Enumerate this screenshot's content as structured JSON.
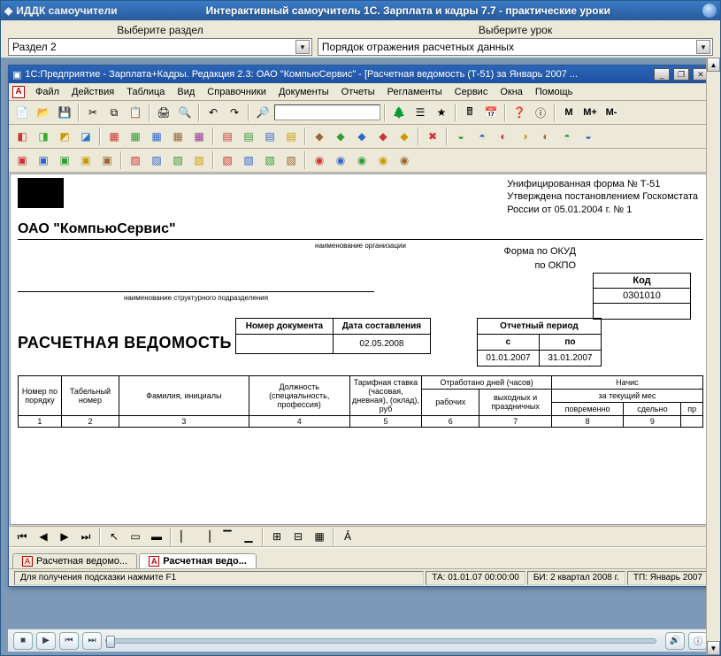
{
  "outer": {
    "app_name": "ИДДК самоучители",
    "title": "Интерактивный самоучитель 1С. Зарплата и кадры 7.7 - практические уроки"
  },
  "selectors": {
    "section_label": "Выберите раздел",
    "lesson_label": "Выберите урок",
    "section_value": "Раздел 2",
    "lesson_value": "Порядок отражения  расчетных данных"
  },
  "inner": {
    "title": "1С:Предприятие - Зарплата+Кадры. Редакция 2.3: ОАО \"КомпьюСервис\" - [Расчетная ведомость (Т-51) за Январь 2007 ..."
  },
  "menu": {
    "items": [
      "Файл",
      "Действия",
      "Таблица",
      "Вид",
      "Справочники",
      "Документы",
      "Отчеты",
      "Регламенты",
      "Сервис",
      "Окна",
      "Помощь"
    ]
  },
  "tb3_text": {
    "m": "M",
    "mplus": "M+",
    "mminus": "M-"
  },
  "doc": {
    "approval1": "Унифицированная форма № Т-51",
    "approval2": "Утверждена постановлением Госкомстата",
    "approval3": "России от 05.01.2004 г. № 1",
    "org_name": "ОАО \"КомпьюСервис\"",
    "org_sub": "наименование организации",
    "subdiv_sub": "наименование структурного подразделения",
    "form_okud_lbl": "Форма по ОКУД",
    "okpo_lbl": "по ОКПО",
    "kod_hdr": "Код",
    "kod_val": "0301010",
    "doc_title": "РАСЧЕТНАЯ ВЕДОМОСТЬ",
    "docnum_hdr": "Номер документа",
    "date_hdr": "Дата составления",
    "date_val": "02.05.2008",
    "period_hdr": "Отчетный период",
    "period_from_hdr": "с",
    "period_to_hdr": "по",
    "period_from": "01.01.2007",
    "period_to": "31.01.2007",
    "col": {
      "seq": "Номер по порядку",
      "tab": "Табельный номер",
      "fio": "Фамилия, инициалы",
      "pos": "Должность (специальность, профессия)",
      "rate": "Тарифная ставка (часовая, дневная), (оклад), руб",
      "worked_hdr": "Отработано дней (часов)",
      "worked_work": "рабочих",
      "worked_holiday": "выходных и праздничных",
      "accr_hdr": "Начис",
      "accr_sub": "за текущий мес",
      "accr_time": "повременно",
      "accr_piece": "сдельно",
      "accr_other": "пр"
    },
    "colnums": [
      "1",
      "2",
      "3",
      "4",
      "5",
      "6",
      "7",
      "8",
      "9"
    ]
  },
  "tabs": {
    "t1": "Расчетная ведомо...",
    "t2": "Расчетная ведо..."
  },
  "status": {
    "hint": "Для получения подсказки нажмите F1",
    "ta": "ТА: 01.01.07  00:00:00",
    "bi": "БИ: 2 квартал 2008 г.",
    "tp": "ТП: Январь 2007"
  }
}
